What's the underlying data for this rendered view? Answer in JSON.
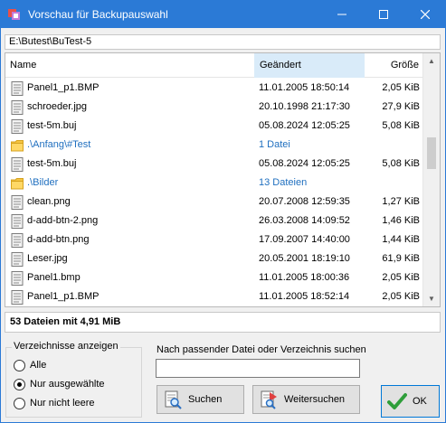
{
  "window": {
    "title": "Vorschau für Backupauswahl"
  },
  "path": "E:\\Butest\\BuTest-5",
  "columns": {
    "name": "Name",
    "date": "Geändert",
    "size": "Größe"
  },
  "rows": [
    {
      "type": "file",
      "name": "Panel1_p1.BMP",
      "date": "11.01.2005 18:50:14",
      "size": "2,05 KiB"
    },
    {
      "type": "file",
      "name": "schroeder.jpg",
      "date": "20.10.1998 21:17:30",
      "size": "27,9 KiB"
    },
    {
      "type": "file",
      "name": "test-5m.buj",
      "date": "05.08.2024 12:05:25",
      "size": "5,08 KiB"
    },
    {
      "type": "dir",
      "name": ".\\Anfang\\#Test",
      "date": "1 Datei",
      "size": ""
    },
    {
      "type": "file",
      "name": "test-5m.buj",
      "date": "05.08.2024 12:05:25",
      "size": "5,08 KiB"
    },
    {
      "type": "dir",
      "name": ".\\Bilder",
      "date": "13 Dateien",
      "size": ""
    },
    {
      "type": "file",
      "name": "clean.png",
      "date": "20.07.2008 12:59:35",
      "size": "1,27 KiB"
    },
    {
      "type": "file",
      "name": "d-add-btn-2.png",
      "date": "26.03.2008 14:09:52",
      "size": "1,46 KiB"
    },
    {
      "type": "file",
      "name": "d-add-btn.png",
      "date": "17.09.2007 14:40:00",
      "size": "1,44 KiB"
    },
    {
      "type": "file",
      "name": "Leser.jpg",
      "date": "20.05.2001 18:19:10",
      "size": "61,9 KiB"
    },
    {
      "type": "file",
      "name": "Panel1.bmp",
      "date": "11.01.2005 18:00:36",
      "size": "2,05 KiB"
    },
    {
      "type": "file",
      "name": "Panel1_p1.BMP",
      "date": "11.01.2005 18:52:14",
      "size": "2,05 KiB"
    }
  ],
  "summary": "53 Dateien mit 4,91 MiB",
  "filter": {
    "legend": "Verzeichnisse anzeigen",
    "options": [
      "Alle",
      "Nur ausgewählte",
      "Nur nicht leere"
    ],
    "selected": "Nur ausgewählte"
  },
  "search": {
    "label": "Nach passender Datei oder Verzeichnis suchen",
    "value": ""
  },
  "buttons": {
    "search": "Suchen",
    "search_next": "Weitersuchen",
    "ok": "OK"
  },
  "colors": {
    "titlebar": "#2b7ad6",
    "dir_text": "#1f6fbf",
    "sorted_header": "#d9ebf9",
    "ok_check": "#2e9e3a"
  }
}
